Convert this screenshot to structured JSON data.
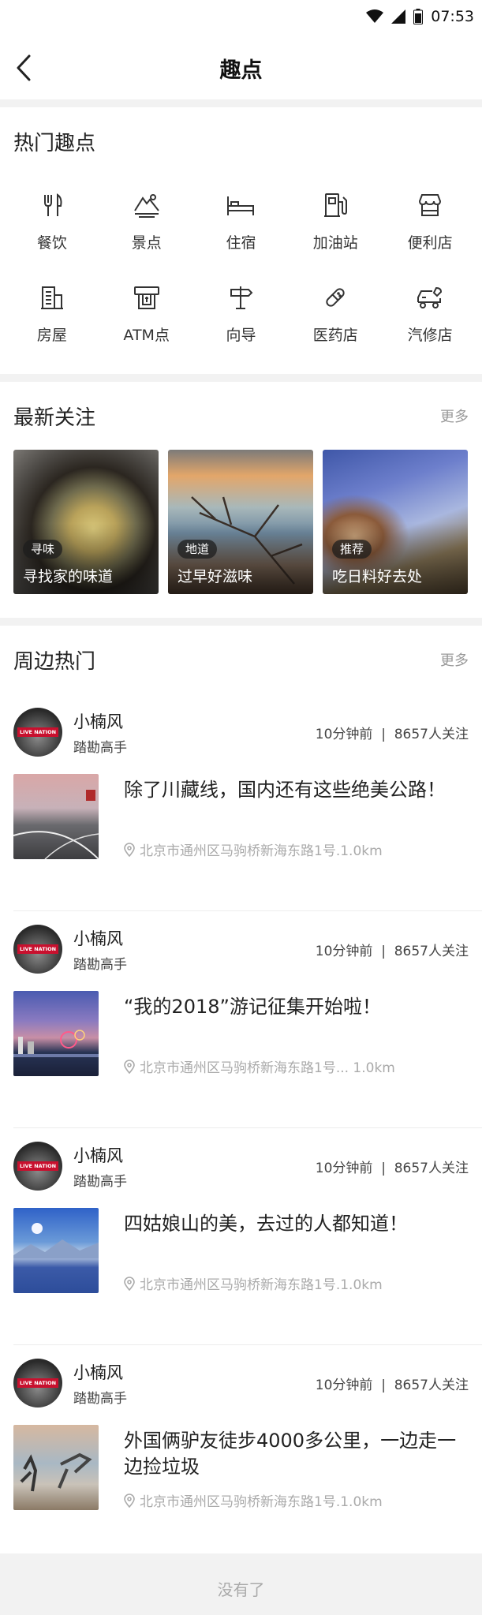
{
  "status": {
    "time": "07:53"
  },
  "nav": {
    "title": "趣点"
  },
  "hot": {
    "title": "热门趣点",
    "categories": [
      {
        "label": "餐饮",
        "icon": "dining-icon"
      },
      {
        "label": "景点",
        "icon": "scenic-icon"
      },
      {
        "label": "住宿",
        "icon": "hotel-bed-icon"
      },
      {
        "label": "加油站",
        "icon": "gas-station-icon"
      },
      {
        "label": "便利店",
        "icon": "convenience-store-icon"
      },
      {
        "label": "房屋",
        "icon": "building-icon"
      },
      {
        "label": "ATM点",
        "icon": "atm-icon"
      },
      {
        "label": "向导",
        "icon": "signpost-icon"
      },
      {
        "label": "医药店",
        "icon": "pill-icon"
      },
      {
        "label": "汽修店",
        "icon": "car-repair-icon"
      }
    ]
  },
  "latest": {
    "title": "最新关注",
    "more": "更多",
    "cards": [
      {
        "tag": "寻味",
        "title": "寻找家的味道"
      },
      {
        "tag": "地道",
        "title": "过早好滋味"
      },
      {
        "tag": "推荐",
        "title": "吃日料好去处"
      }
    ]
  },
  "nearby": {
    "title": "周边热门",
    "more": "更多",
    "posts": [
      {
        "user": "小楠风",
        "level": "踏勘高手",
        "time": "10分钟前",
        "followers": "8657人关注",
        "title": "除了川藏线，国内还有这些绝美公路！",
        "location": "北京市通州区马驹桥新海东路1号.1.0km"
      },
      {
        "user": "小楠风",
        "level": "踏勘高手",
        "time": "10分钟前",
        "followers": "8657人关注",
        "title": "“我的2018”游记征集开始啦！",
        "location": "北京市通州区马驹桥新海东路1号...  1.0km"
      },
      {
        "user": "小楠风",
        "level": "踏勘高手",
        "time": "10分钟前",
        "followers": "8657人关注",
        "title": "四姑娘山的美，去过的人都知道！",
        "location": "北京市通州区马驹桥新海东路1号.1.0km"
      },
      {
        "user": "小楠风",
        "level": "踏勘高手",
        "time": "10分钟前",
        "followers": "8657人关注",
        "title": "外国俩驴友徒步4000多公里，一边走一边捡垃圾",
        "location": "北京市通州区马驹桥新海东路1号.1.0km"
      }
    ],
    "avatar_text": "LIVE NATION"
  },
  "footer": {
    "text": "没有了"
  }
}
